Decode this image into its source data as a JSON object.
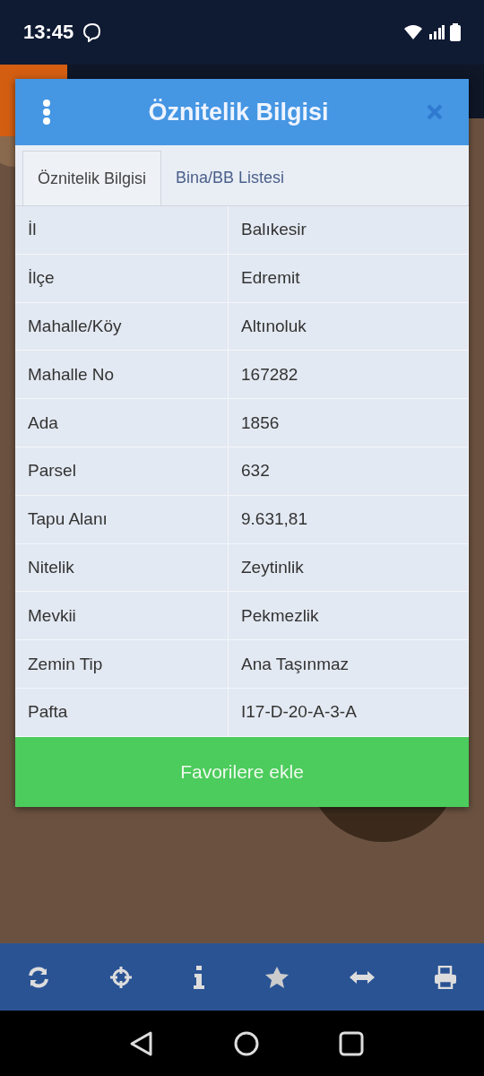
{
  "status_bar": {
    "time": "13:45"
  },
  "dialog": {
    "title": "Öznitelik Bilgisi",
    "tabs": [
      {
        "label": "Öznitelik Bilgisi",
        "selected": true
      },
      {
        "label": "Bina/BB Listesi",
        "selected": false
      }
    ],
    "rows": [
      {
        "label": "İl",
        "value": "Balıkesir"
      },
      {
        "label": "İlçe",
        "value": "Edremit"
      },
      {
        "label": "Mahalle/Köy",
        "value": "Altınoluk"
      },
      {
        "label": "Mahalle No",
        "value": "167282"
      },
      {
        "label": "Ada",
        "value": "1856"
      },
      {
        "label": "Parsel",
        "value": "632"
      },
      {
        "label": "Tapu Alanı",
        "value": "9.631,81"
      },
      {
        "label": "Nitelik",
        "value": "Zeytinlik"
      },
      {
        "label": "Mevkii",
        "value": "Pekmezlik"
      },
      {
        "label": "Zemin Tip",
        "value": "Ana Taşınmaz"
      },
      {
        "label": "Pafta",
        "value": "I17-D-20-A-3-A"
      }
    ],
    "button": "Favorilere ekle"
  }
}
